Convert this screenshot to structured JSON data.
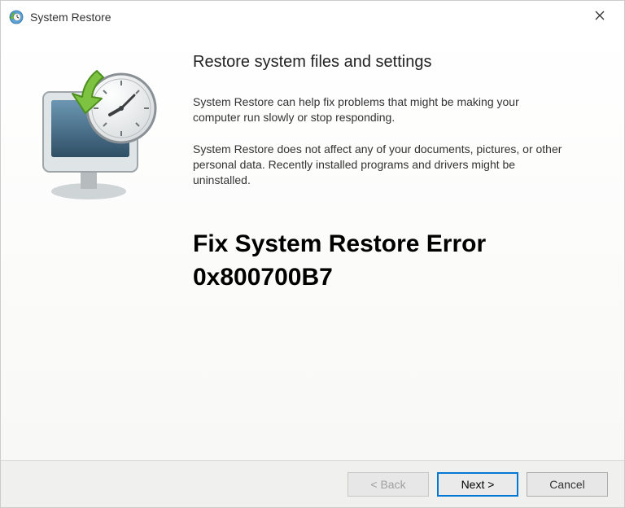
{
  "window": {
    "title": "System Restore"
  },
  "main": {
    "heading": "Restore system files and settings",
    "paragraph1": "System Restore can help fix problems that might be making your computer run slowly or stop responding.",
    "paragraph2": "System Restore does not affect any of your documents, pictures, or other personal data. Recently installed programs and drivers might be uninstalled.",
    "error_text": "Fix System Restore Error 0x800700B7"
  },
  "footer": {
    "back_label": "< Back",
    "next_label": "Next >",
    "cancel_label": "Cancel"
  },
  "icons": {
    "app": "system-restore-icon",
    "close": "close-icon",
    "illustration": "restore-monitor-clock-icon"
  }
}
